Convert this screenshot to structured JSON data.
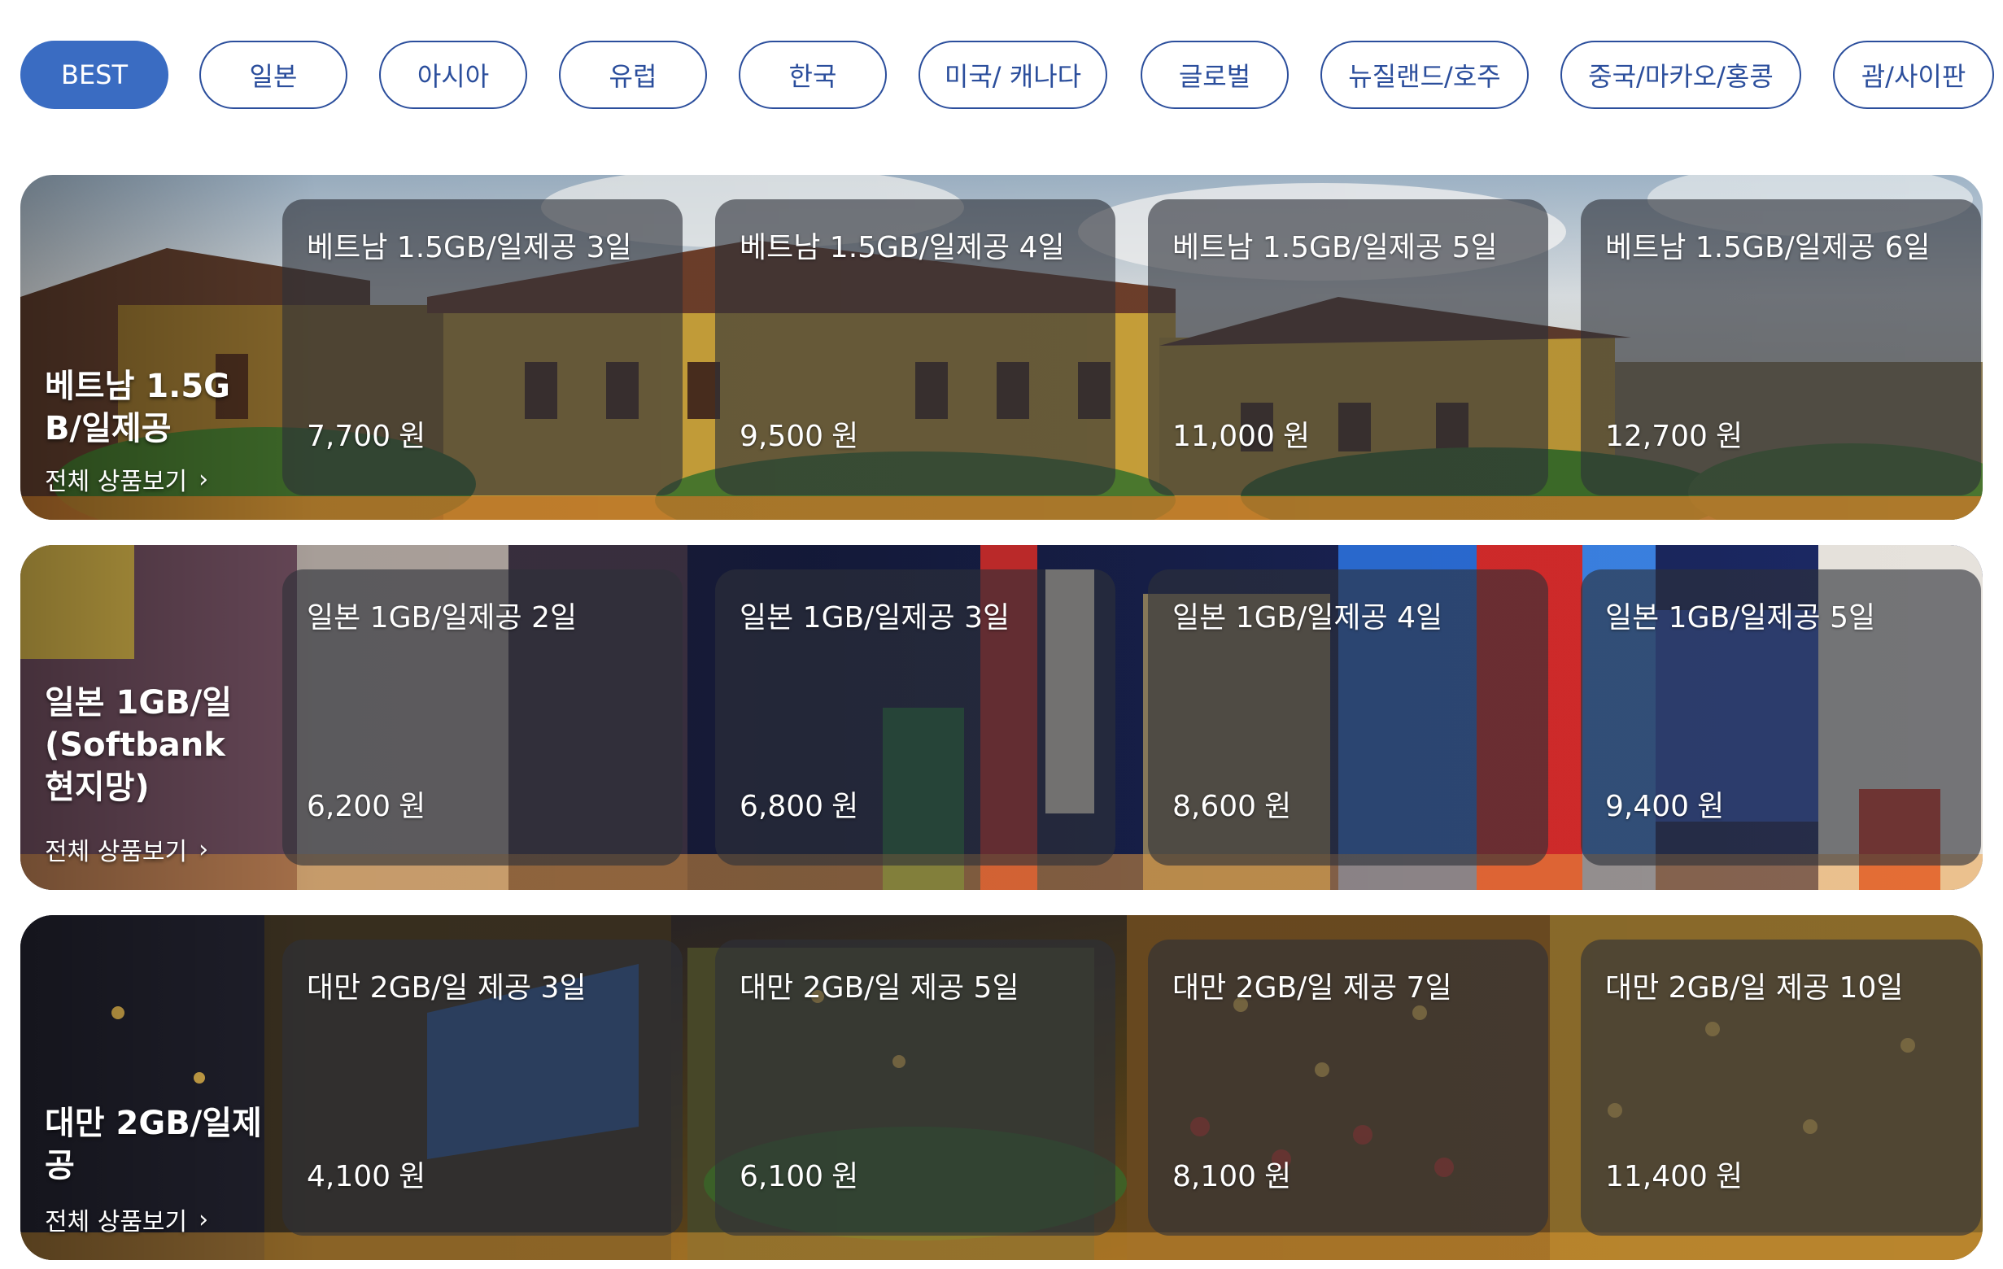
{
  "tabs": [
    {
      "label": "BEST",
      "active": true
    },
    {
      "label": "일본"
    },
    {
      "label": "아시아"
    },
    {
      "label": "유럽"
    },
    {
      "label": "한국"
    },
    {
      "label": "미국/ 캐나다"
    },
    {
      "label": "글로벌"
    },
    {
      "label": "뉴질랜드/호주"
    },
    {
      "label": "중국/마카오/홍콩"
    },
    {
      "label": "괌/사이판"
    }
  ],
  "sections": [
    {
      "title": "베트남 1.5GB/일제공",
      "link_label": "전체 상품보기",
      "products": [
        {
          "name": "베트남 1.5GB/일제공 3일",
          "price": "7,700",
          "unit": "원"
        },
        {
          "name": "베트남 1.5GB/일제공 4일",
          "price": "9,500",
          "unit": "원"
        },
        {
          "name": "베트남 1.5GB/일제공 5일",
          "price": "11,000",
          "unit": "원"
        },
        {
          "name": "베트남 1.5GB/일제공 6일",
          "price": "12,700",
          "unit": "원"
        }
      ]
    },
    {
      "title": "일본 1GB/일(Softbank 현지망)",
      "link_label": "전체 상품보기",
      "products": [
        {
          "name": "일본 1GB/일제공 2일",
          "price": "6,200",
          "unit": "원"
        },
        {
          "name": "일본 1GB/일제공 3일",
          "price": "6,800",
          "unit": "원"
        },
        {
          "name": "일본 1GB/일제공 4일",
          "price": "8,600",
          "unit": "원"
        },
        {
          "name": "일본 1GB/일제공 5일",
          "price": "9,400",
          "unit": "원"
        }
      ]
    },
    {
      "title": "대만 2GB/일제공",
      "link_label": "전체 상품보기",
      "products": [
        {
          "name": "대만 2GB/일 제공 3일",
          "price": "4,100",
          "unit": "원"
        },
        {
          "name": "대만 2GB/일 제공 5일",
          "price": "6,100",
          "unit": "원"
        },
        {
          "name": "대만 2GB/일 제공 7일",
          "price": "8,100",
          "unit": "원"
        },
        {
          "name": "대만 2GB/일 제공 10일",
          "price": "11,400",
          "unit": "원"
        }
      ]
    }
  ],
  "colors": {
    "tab_border": "#2b4e9c",
    "tab_active_bg": "#3a6cc2"
  }
}
